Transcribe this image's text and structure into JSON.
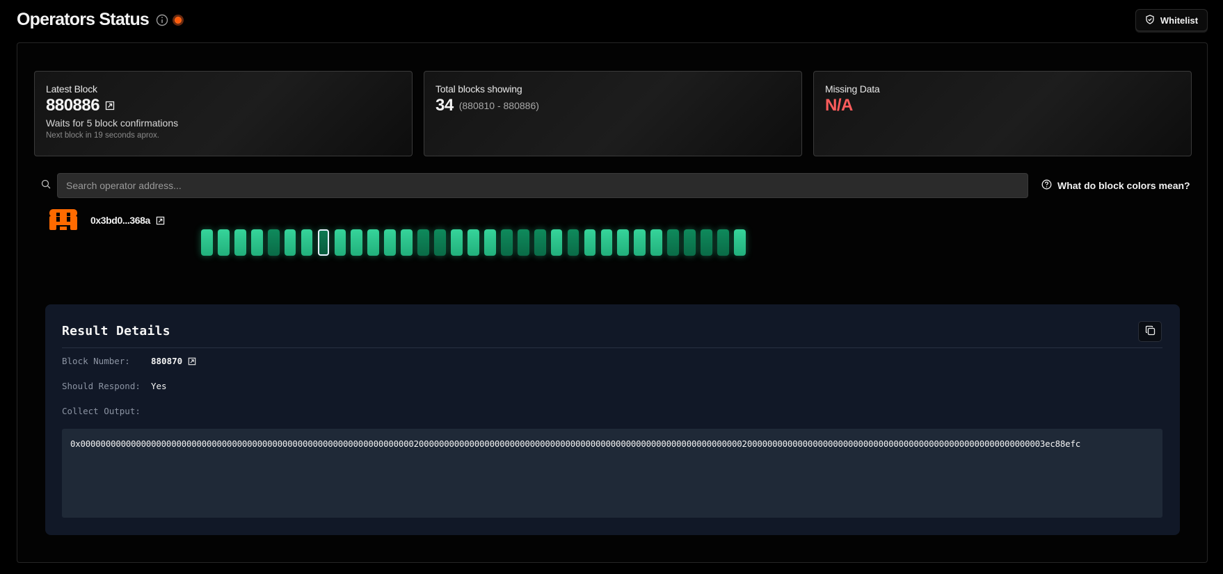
{
  "header": {
    "title": "Operators Status",
    "info_icon": "info-icon",
    "status_color": "#ff5a0a"
  },
  "whitelist": {
    "label": "Whitelist",
    "icon": "shield-check-icon"
  },
  "cards": {
    "latest_block": {
      "label": "Latest Block",
      "value": "880886",
      "confirmations": "Waits for 5 block confirmations",
      "next_block": "Next block in 19 seconds aprox."
    },
    "total_blocks": {
      "label": "Total blocks showing",
      "value": "34",
      "range": "(880810 - 880886)"
    },
    "missing_data": {
      "label": "Missing Data",
      "value": "N/A",
      "value_color": "#ff5c5c"
    }
  },
  "search": {
    "placeholder": "Search operator address...",
    "value": ""
  },
  "help": {
    "label": "What do block colors mean?",
    "icon": "question-circle-icon"
  },
  "operator": {
    "address": "0x3bd0...368a",
    "logo": "operator-logo",
    "blocks": [
      "light",
      "light",
      "light",
      "light",
      "dark",
      "light",
      "light",
      "selected",
      "light",
      "light",
      "light",
      "light",
      "light",
      "dark",
      "dark",
      "light",
      "light",
      "light",
      "dark",
      "dark",
      "dark",
      "light",
      "dark",
      "light",
      "light",
      "light",
      "light",
      "light",
      "dark",
      "dark",
      "dark",
      "dark",
      "light"
    ],
    "block_colors": {
      "light": "#2cc48b",
      "dark": "#0c7a51",
      "selected_outline": "#e8f2ff"
    }
  },
  "details": {
    "title": "Result Details",
    "block_number_label": "Block Number:",
    "block_number": "880870",
    "should_respond_label": "Should Respond:",
    "should_respond": "Yes",
    "collect_output_label": "Collect Output:",
    "collect_output": "0x00000000000000000000000000000000000000000000000000000000000000000020000000000000000000000000000000000000000000000000000000000000000200000000000000000000000000000000000000000000000000000000003ec88efc"
  }
}
